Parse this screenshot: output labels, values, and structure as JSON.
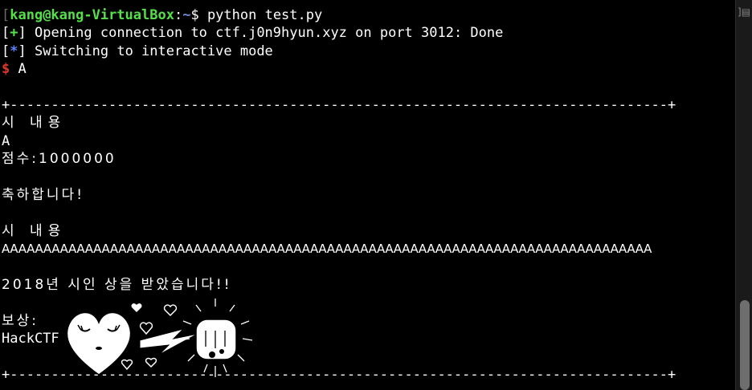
{
  "prompt": {
    "open_bracket": "[",
    "user_host": "kang@kang-VirtualBox",
    "colon": ":",
    "path": "~",
    "symbol": "$ ",
    "command": "python test.py"
  },
  "output": {
    "line1_bracket_open": "[",
    "line1_mark": "+",
    "line1_bracket_close": "]",
    "line1_text": " Opening connection to ctf.j0n9hyun.xyz on port 3012: Done",
    "line2_bracket_open": "[",
    "line2_mark": "*",
    "line2_bracket_close": "]",
    "line2_text": " Switching to interactive mode",
    "line3_dollar": "$",
    "line3_text": " A",
    "border_top": "+--------------------------------------------------------------------------------+",
    "poem_label_1": "시 내용",
    "poem_content_1": "A",
    "score": "점수:1000000",
    "congrats": "축하합니다!",
    "poem_label_2": "시 내용",
    "poem_content_2": "AAAAAAAAAAAAAAAAAAAAAAAAAAAAAAAAAAAAAAAAAAAAAAAAAAAAAAAAAAAAAAAAAAAAAAAAAAAAAA",
    "award": "2018년 시인 상을 받았습니다!!",
    "reward_label": "보상:",
    "reward_value": "HackCTF",
    "border_bottom": "+--------------------------------------------------------------------------------+"
  },
  "scrollbar": {
    "right_bracket": "]",
    "menu_icon": "menu-icon"
  },
  "colors": {
    "background": "#000000",
    "green": "#55e04a",
    "blue": "#5b82ff",
    "red": "#e0382a",
    "path": "#6d8bd6"
  }
}
